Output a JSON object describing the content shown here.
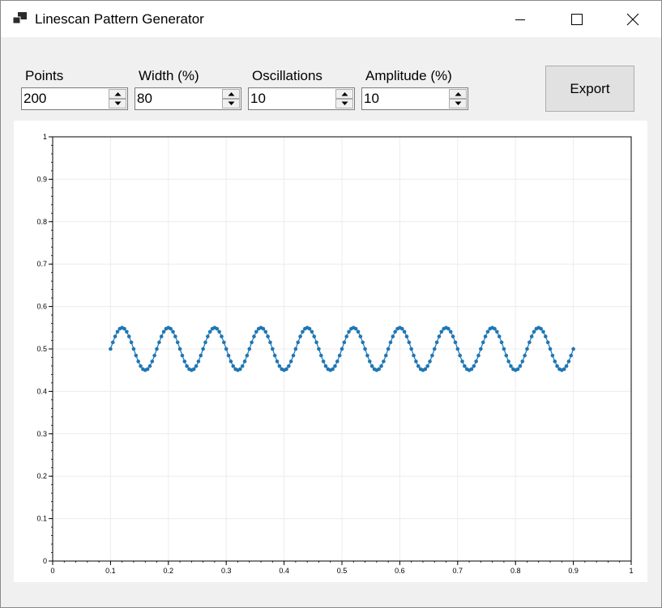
{
  "window": {
    "title": "Linescan Pattern Generator",
    "controls": {
      "minimize": "minimize-icon",
      "maximize": "maximize-icon",
      "close": "close-icon"
    }
  },
  "controls": {
    "points": {
      "label": "Points",
      "value": "200"
    },
    "width": {
      "label": "Width (%)",
      "value": "80"
    },
    "oscillations": {
      "label": "Oscillations",
      "value": "10"
    },
    "amplitude": {
      "label": "Amplitude (%)",
      "value": "10"
    },
    "export_label": "Export"
  },
  "colors": {
    "series": "#1f77b4",
    "grid": "#ececec",
    "axis": "#000000"
  },
  "chart_data": {
    "type": "scatter",
    "title": "",
    "xlabel": "",
    "ylabel": "",
    "xlim": [
      0,
      1
    ],
    "ylim": [
      0,
      1
    ],
    "xticks": [
      "0",
      "0.1",
      "0.2",
      "0.3",
      "0.4",
      "0.5",
      "0.6",
      "0.7",
      "0.8",
      "0.9",
      "1"
    ],
    "yticks": [
      "0",
      "0.1",
      "0.2",
      "0.3",
      "0.4",
      "0.5",
      "0.6",
      "0.7",
      "0.8",
      "0.9",
      "1"
    ],
    "grid": true,
    "line_connected": true,
    "series": [
      {
        "x": [
          0.1,
          0.104,
          0.108,
          0.112,
          0.116,
          0.12,
          0.124,
          0.128,
          0.132,
          0.136,
          0.14,
          0.144,
          0.148,
          0.152,
          0.156,
          0.16,
          0.164,
          0.168,
          0.172,
          0.176,
          0.18,
          0.184,
          0.188,
          0.192,
          0.196,
          0.2,
          0.204,
          0.208,
          0.212,
          0.216,
          0.22,
          0.224,
          0.228,
          0.232,
          0.236,
          0.24,
          0.244,
          0.248,
          0.252,
          0.256,
          0.26,
          0.264,
          0.268,
          0.272,
          0.276,
          0.28,
          0.284,
          0.288,
          0.292,
          0.296,
          0.3,
          0.304,
          0.308,
          0.312,
          0.316,
          0.32,
          0.324,
          0.328,
          0.332,
          0.336,
          0.34,
          0.344,
          0.348,
          0.352,
          0.356,
          0.36,
          0.364,
          0.368,
          0.372,
          0.376,
          0.38,
          0.384,
          0.388,
          0.392,
          0.396,
          0.4,
          0.404,
          0.408,
          0.412,
          0.416,
          0.42,
          0.424,
          0.428,
          0.432,
          0.436,
          0.44,
          0.444,
          0.448,
          0.452,
          0.456,
          0.46,
          0.464,
          0.468,
          0.472,
          0.476,
          0.48,
          0.484,
          0.488,
          0.492,
          0.496,
          0.5,
          0.504,
          0.508,
          0.512,
          0.516,
          0.52,
          0.524,
          0.528,
          0.532,
          0.536,
          0.54,
          0.544,
          0.548,
          0.552,
          0.556,
          0.56,
          0.564,
          0.568,
          0.572,
          0.576,
          0.58,
          0.584,
          0.588,
          0.592,
          0.596,
          0.6,
          0.604,
          0.608,
          0.612,
          0.616,
          0.62,
          0.624,
          0.628,
          0.632,
          0.636,
          0.64,
          0.644,
          0.648,
          0.652,
          0.656,
          0.66,
          0.664,
          0.668,
          0.672,
          0.676,
          0.68,
          0.684,
          0.688,
          0.692,
          0.696,
          0.7,
          0.704,
          0.708,
          0.712,
          0.716,
          0.72,
          0.724,
          0.728,
          0.732,
          0.736,
          0.74,
          0.744,
          0.748,
          0.752,
          0.756,
          0.76,
          0.764,
          0.768,
          0.772,
          0.776,
          0.78,
          0.784,
          0.788,
          0.792,
          0.796,
          0.8,
          0.804,
          0.808,
          0.812,
          0.816,
          0.82,
          0.824,
          0.828,
          0.832,
          0.836,
          0.84,
          0.844,
          0.848,
          0.852,
          0.856,
          0.86,
          0.864,
          0.868,
          0.872,
          0.876,
          0.88,
          0.884,
          0.888,
          0.892,
          0.896,
          0.9
        ],
        "y": [
          0.5,
          0.5155,
          0.5294,
          0.5405,
          0.5476,
          0.55,
          0.5476,
          0.5405,
          0.5294,
          0.5155,
          0.5,
          0.4845,
          0.4706,
          0.4595,
          0.4524,
          0.45,
          0.4524,
          0.4595,
          0.4706,
          0.4845,
          0.5,
          0.5155,
          0.5294,
          0.5405,
          0.5476,
          0.55,
          0.5476,
          0.5405,
          0.5294,
          0.5155,
          0.5,
          0.4845,
          0.4706,
          0.4595,
          0.4524,
          0.45,
          0.4524,
          0.4595,
          0.4706,
          0.4845,
          0.5,
          0.5155,
          0.5294,
          0.5405,
          0.5476,
          0.55,
          0.5476,
          0.5405,
          0.5294,
          0.5155,
          0.5,
          0.4845,
          0.4706,
          0.4595,
          0.4524,
          0.45,
          0.4524,
          0.4595,
          0.4706,
          0.4845,
          0.5,
          0.5155,
          0.5294,
          0.5405,
          0.5476,
          0.55,
          0.5476,
          0.5405,
          0.5294,
          0.5155,
          0.5,
          0.4845,
          0.4706,
          0.4595,
          0.4524,
          0.45,
          0.4524,
          0.4595,
          0.4706,
          0.4845,
          0.5,
          0.5155,
          0.5294,
          0.5405,
          0.5476,
          0.55,
          0.5476,
          0.5405,
          0.5294,
          0.5155,
          0.5,
          0.4845,
          0.4706,
          0.4595,
          0.4524,
          0.45,
          0.4524,
          0.4595,
          0.4706,
          0.4845,
          0.5,
          0.5155,
          0.5294,
          0.5405,
          0.5476,
          0.55,
          0.5476,
          0.5405,
          0.5294,
          0.5155,
          0.5,
          0.4845,
          0.4706,
          0.4595,
          0.4524,
          0.45,
          0.4524,
          0.4595,
          0.4706,
          0.4845,
          0.5,
          0.5155,
          0.5294,
          0.5405,
          0.5476,
          0.55,
          0.5476,
          0.5405,
          0.5294,
          0.5155,
          0.5,
          0.4845,
          0.4706,
          0.4595,
          0.4524,
          0.45,
          0.4524,
          0.4595,
          0.4706,
          0.4845,
          0.5,
          0.5155,
          0.5294,
          0.5405,
          0.5476,
          0.55,
          0.5476,
          0.5405,
          0.5294,
          0.5155,
          0.5,
          0.4845,
          0.4706,
          0.4595,
          0.4524,
          0.45,
          0.4524,
          0.4595,
          0.4706,
          0.4845,
          0.5,
          0.5155,
          0.5294,
          0.5405,
          0.5476,
          0.55,
          0.5476,
          0.5405,
          0.5294,
          0.5155,
          0.5,
          0.4845,
          0.4706,
          0.4595,
          0.4524,
          0.45,
          0.4524,
          0.4595,
          0.4706,
          0.4845,
          0.5,
          0.5155,
          0.5294,
          0.5405,
          0.5476,
          0.55,
          0.5476,
          0.5405,
          0.5294,
          0.5155,
          0.5,
          0.4845,
          0.4706,
          0.4595,
          0.4524,
          0.45,
          0.4524,
          0.4595,
          0.4706,
          0.4845,
          0.5
        ]
      }
    ]
  }
}
